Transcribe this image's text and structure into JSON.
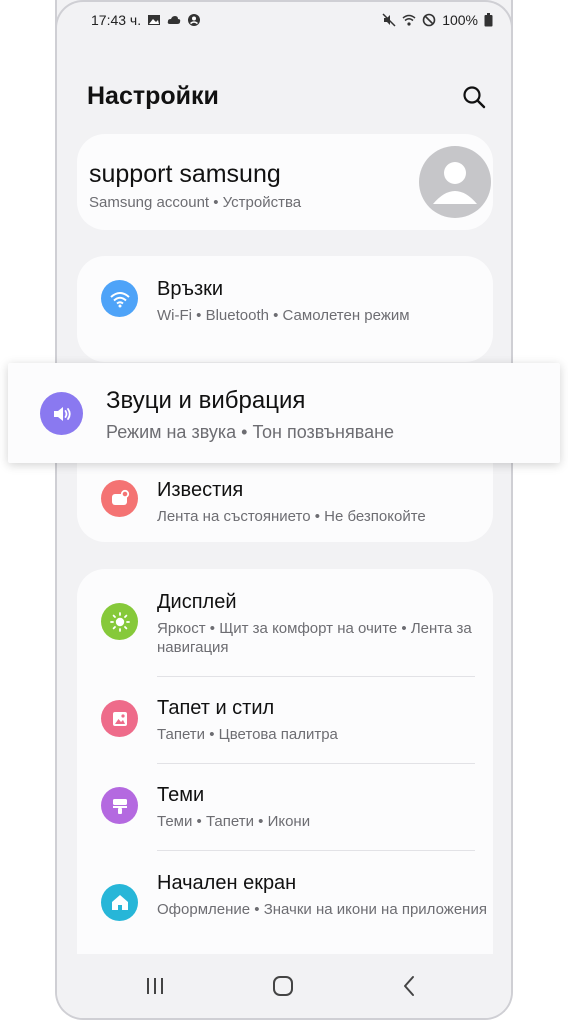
{
  "status_bar": {
    "time": "17:43 ч.",
    "battery": "100%"
  },
  "header": {
    "title": "Настройки"
  },
  "profile": {
    "name": "support samsung",
    "subtitle": "Samsung account  •  Устройства"
  },
  "settings": [
    {
      "title": "Връзки",
      "subtitle": "Wi-Fi  •  Bluetooth  •  Самолетен режим",
      "icon": "wifi-icon",
      "color": "#4ea3f8"
    },
    {
      "title": "Звуци и вибрация",
      "subtitle": "Режим на звука  •  Тон позвъняване",
      "icon": "speaker-icon",
      "color": "#8a79f0"
    },
    {
      "title": "Известия",
      "subtitle": "Лента на състоянието  •  Не безпокойте",
      "icon": "notification-icon",
      "color": "#f47373"
    },
    {
      "title": "Дисплей",
      "subtitle": "Яркост  •  Щит за комфорт на очите  •  Лента за навигация",
      "icon": "sun-icon",
      "color": "#86c93a"
    },
    {
      "title": "Тапет и стил",
      "subtitle": "Тапети  •  Цветова палитра",
      "icon": "wallpaper-icon",
      "color": "#ee6b8a"
    },
    {
      "title": "Теми",
      "subtitle": "Теми  •  Тапети  •  Икони",
      "icon": "brush-icon",
      "color": "#b469e0"
    },
    {
      "title": "Начален екран",
      "subtitle": "Оформление  •  Значки на икони на приложения",
      "icon": "home-icon",
      "color": "#27b6d8"
    }
  ]
}
